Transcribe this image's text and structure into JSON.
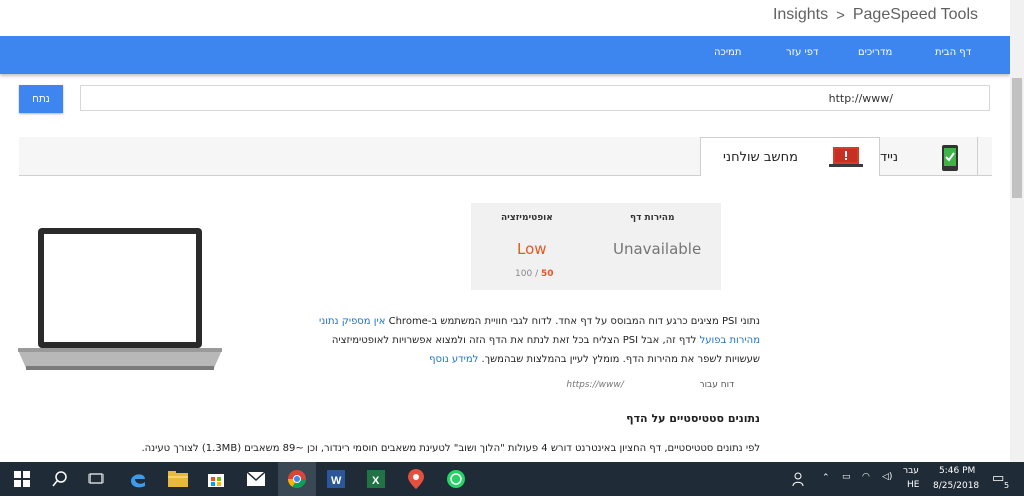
{
  "breadcrumb": {
    "insights": "Insights",
    "separator": ">",
    "pagespeed": "PageSpeed Tools"
  },
  "nav": {
    "items": [
      {
        "label": "דף הבית"
      },
      {
        "label": "מדריכים"
      },
      {
        "label": "דפי עזר"
      },
      {
        "label": "תמיכה"
      }
    ]
  },
  "url_bar": {
    "analyze_label": "נתח",
    "value": "http://www/"
  },
  "tabs": {
    "desktop": "מחשב שולחני",
    "mobile": "נייד"
  },
  "score_card": {
    "speed_heading": "מהירות דף",
    "speed_value": "Unavailable",
    "optimization_heading": "אופטימיזציה",
    "optimization_value": "Low",
    "optimization_score": "50",
    "optimization_sep": "/",
    "optimization_max": "100",
    "colors": {
      "low": "#e05a28",
      "unavailable": "#757575",
      "score": "#e05a28"
    }
  },
  "description": {
    "line1_start": "נתוני PSI מציגים כרגע דוח המבוסס על דף אחד. לדוח לגבי חוויית המשתמש ב-Chrome ",
    "line1_link": "אין מספיק נתוני",
    "line2_link": "מהירות בפועל",
    "line2_rest": " לדף זה, אבל PSI הצליח בכל זאת לנתח את הדף הזה ולמצוא אפשרויות לאופטימיזציה",
    "line3_rest": "שעשויות לשפר את מהירות הדף. מומלץ לעיין בהמלצות שבהמשך. ",
    "line3_link": "למידע נוסף"
  },
  "report_for": {
    "label": "דוח עבור",
    "url": "https://www/"
  },
  "section": {
    "title": "נתונים סטטיסטיים על הדף",
    "text": "לפי נתונים סטטיסטיים, דף החציון באינטרנט דורש 4 פעולות \"הלוך ושוב\" לטעינת משאבים חוסמי רינדור, וכן ~89 משאבים (1.3MB) לצורך טעינה."
  },
  "taskbar": {
    "lang_top": "עבר",
    "lang_bottom": "HE",
    "time": "5:46 PM",
    "date": "8/25/2018",
    "notifications": "5"
  },
  "accent": "#3d86f0"
}
